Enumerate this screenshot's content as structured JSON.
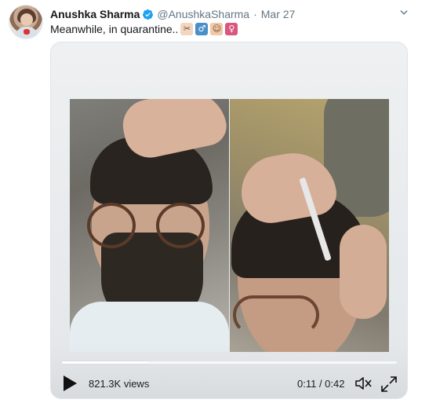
{
  "tweet": {
    "author_name": "Anushka Sharma",
    "author_handle": "@AnushkaSharma",
    "separator": "·",
    "timestamp": "Mar 27",
    "text": "Meanwhile, in quarantine..",
    "emojis": [
      "barber-emoji",
      "male-sign-emoji",
      "person-emoji",
      "female-sign-emoji"
    ]
  },
  "video": {
    "views": "821.3K views",
    "time": "0:11 / 0:42",
    "progress_fraction": 0.26
  },
  "icons": {
    "verified": "verified-badge-icon",
    "caret": "chevron-down-icon",
    "play": "play-icon",
    "mute": "speaker-muted-icon",
    "expand": "expand-icon"
  },
  "colors": {
    "verified": "#1da1f2",
    "secondary_text": "#657786"
  }
}
